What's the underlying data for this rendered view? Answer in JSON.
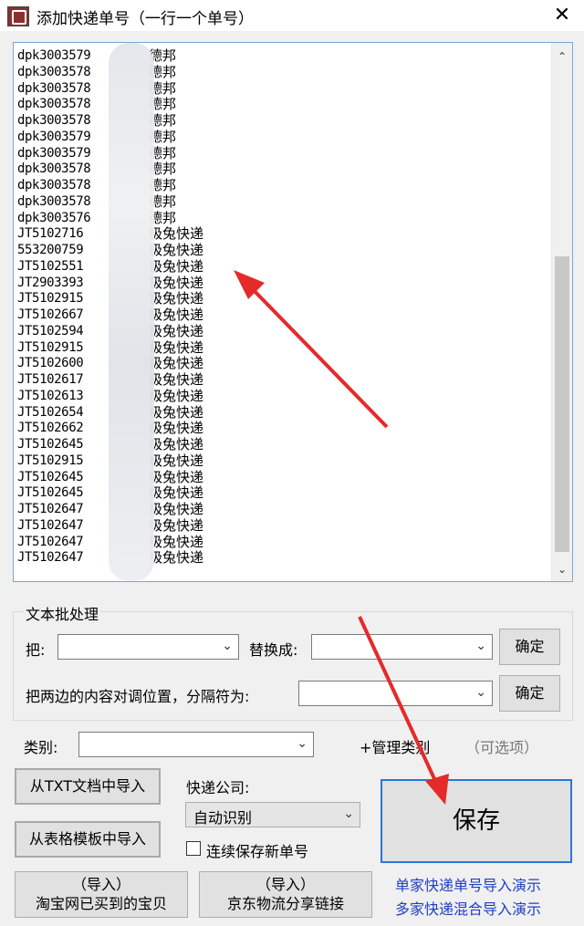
{
  "window": {
    "title": "添加快递单号（一行一个单号）",
    "close_glyph": "✕"
  },
  "list": {
    "rows": [
      {
        "code": "dpk3003579",
        "carrier": "德邦"
      },
      {
        "code": "dpk3003578",
        "carrier": "德邦"
      },
      {
        "code": "dpk3003578",
        "carrier": "德邦"
      },
      {
        "code": "dpk3003578",
        "carrier": "德邦"
      },
      {
        "code": "dpk3003578",
        "carrier": "德邦"
      },
      {
        "code": "dpk3003579",
        "carrier": "德邦"
      },
      {
        "code": "dpk3003579",
        "carrier": "德邦"
      },
      {
        "code": "dpk3003578",
        "carrier": "德邦"
      },
      {
        "code": "dpk3003578",
        "carrier": "德邦"
      },
      {
        "code": "dpk3003578",
        "carrier": "德邦"
      },
      {
        "code": "dpk3003576",
        "carrier": "德邦"
      },
      {
        "code": "JT5102716",
        "carrier": "极兔快递"
      },
      {
        "code": "553200759",
        "carrier": "极兔快递"
      },
      {
        "code": "JT5102551",
        "carrier": "极兔快递"
      },
      {
        "code": "JT2903393",
        "carrier": "极兔快递"
      },
      {
        "code": "JT5102915",
        "carrier": "极兔快递"
      },
      {
        "code": "JT5102667",
        "carrier": "极兔快递"
      },
      {
        "code": "JT5102594",
        "carrier": "极兔快递"
      },
      {
        "code": "JT5102915",
        "carrier": "极兔快递"
      },
      {
        "code": "JT5102600",
        "carrier": "极兔快递"
      },
      {
        "code": "JT5102617",
        "carrier": "极兔快递"
      },
      {
        "code": "JT5102613",
        "carrier": "极兔快递"
      },
      {
        "code": "JT5102654",
        "carrier": "极兔快递"
      },
      {
        "code": "JT5102662",
        "carrier": "极兔快递"
      },
      {
        "code": "JT5102645",
        "carrier": "极兔快递"
      },
      {
        "code": "JT5102915",
        "carrier": "极兔快递"
      },
      {
        "code": "JT5102645",
        "carrier": "极兔快递"
      },
      {
        "code": "JT5102645",
        "carrier": "极兔快递"
      },
      {
        "code": "JT5102647",
        "carrier": "极兔快递"
      },
      {
        "code": "JT5102647",
        "carrier": "极兔快递"
      },
      {
        "code": "JT5102647",
        "carrier": "极兔快递"
      },
      {
        "code": "JT5102647",
        "carrier": "极兔快递"
      }
    ]
  },
  "batch": {
    "group_title": "文本批处理",
    "replace_from_label": "把:",
    "replace_to_label": "替换成:",
    "confirm1": "确定",
    "swap_label": "把两边的内容对调位置，分隔符为:",
    "confirm2": "确定"
  },
  "category": {
    "label": "类别:",
    "manage_link": "+管理类别",
    "optional": "（可选项）"
  },
  "import": {
    "txt": "从TXT文档中导入",
    "template": "从表格模板中导入",
    "taobao_line1": "（导入）",
    "taobao_line2": "淘宝网已买到的宝贝",
    "jd_line1": "（导入）",
    "jd_line2": "京东物流分享链接"
  },
  "courier": {
    "label": "快递公司:",
    "selected": "自动识别",
    "continuous_label": "连续保存新单号"
  },
  "save_label": "保存",
  "demo_links": {
    "single": "单家快递单号导入演示",
    "multi": "多家快递混合导入演示"
  },
  "colors": {
    "accent": "#2a78d4",
    "link": "#1f3fc4",
    "annotation_arrow": "#e52a2a"
  }
}
